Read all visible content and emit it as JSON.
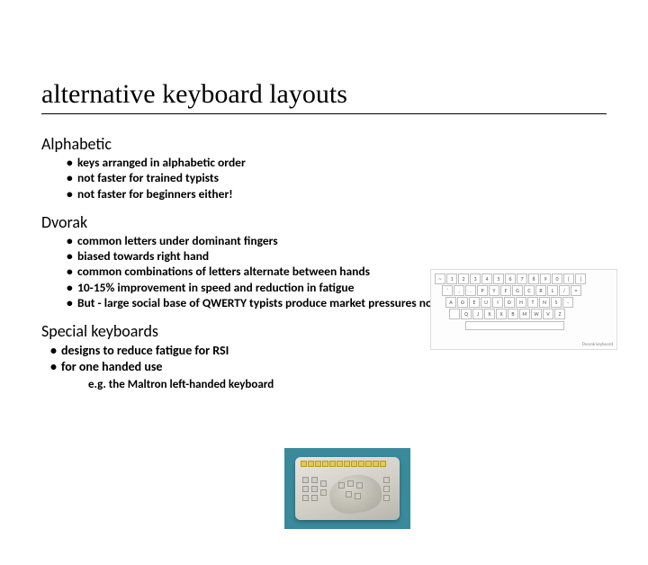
{
  "title": "alternative keyboard layouts",
  "sections": {
    "alphabetic": {
      "heading": "Alphabetic",
      "bullets": [
        "keys arranged in alphabetic order",
        "not faster for trained typists",
        "not faster for beginners either!"
      ]
    },
    "dvorak": {
      "heading": "Dvorak",
      "bullets": [
        "common letters under dominant fingers",
        "biased towards right hand",
        "common combinations of letters alternate between hands",
        "10-15% improvement in speed and reduction in fatigue",
        "But - large social base of QWERTY typists produce market pressures not to change"
      ],
      "keyboard_layout": {
        "row1": [
          "~",
          "1",
          "2",
          "3",
          "4",
          "5",
          "6",
          "7",
          "8",
          "9",
          "0",
          "[",
          "]"
        ],
        "row2": [
          "'",
          ",",
          ".",
          "P",
          "Y",
          "F",
          "G",
          "C",
          "R",
          "L",
          "/",
          "="
        ],
        "row3": [
          "A",
          "O",
          "E",
          "U",
          "I",
          "D",
          "H",
          "T",
          "N",
          "S",
          "-"
        ],
        "row4": [
          "",
          "Q",
          "J",
          "K",
          "X",
          "B",
          "M",
          "W",
          "V",
          "Z"
        ],
        "caption": "Dvorak keyboard"
      }
    },
    "special": {
      "heading": "Special keyboards",
      "bullets": [
        "designs to reduce fatigue for RSI",
        "for one handed use"
      ],
      "example": "e.g. the Maltron left-handed keyboard"
    }
  }
}
